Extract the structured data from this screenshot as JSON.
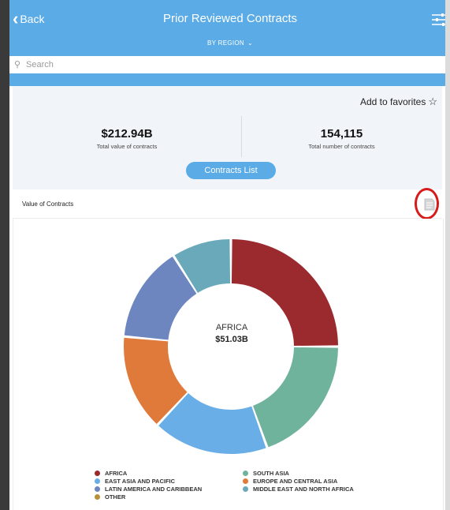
{
  "header": {
    "back_label": "Back",
    "title": "Prior Reviewed Contracts",
    "region_label": "BY REGION",
    "menu_icon": "sliders-icon"
  },
  "search": {
    "placeholder": "Search"
  },
  "favorites": {
    "label": "Add to favorites"
  },
  "stats": {
    "total_value": "$212.94B",
    "total_value_label": "Total value of contracts",
    "total_number": "154,115",
    "total_number_label": "Total number of contracts"
  },
  "contracts_button": "Contracts List",
  "section": {
    "title": "Value of Contracts"
  },
  "donut_center": {
    "name": "AFRICA",
    "value": "$51.03B"
  },
  "colors": {
    "accent": "#5aabe6",
    "highlight": "#d71a1a"
  },
  "chart_data": {
    "type": "pie",
    "hole": true,
    "categories": [
      "AFRICA",
      "SOUTH ASIA",
      "EAST ASIA AND PACIFIC",
      "EUROPE AND CENTRAL ASIA",
      "LATIN AMERICA AND CARIBBEAN",
      "MIDDLE EAST AND NORTH AFRICA",
      "OTHER"
    ],
    "values": [
      0.25,
      0.195,
      0.175,
      0.145,
      0.145,
      0.09,
      0
    ],
    "colors": [
      "#9b2a2f",
      "#6fb39c",
      "#6aaee7",
      "#e07a3a",
      "#6d86c0",
      "#6aa9ba",
      "#b8923a"
    ],
    "selected": "AFRICA",
    "selected_value": "$51.03B"
  }
}
